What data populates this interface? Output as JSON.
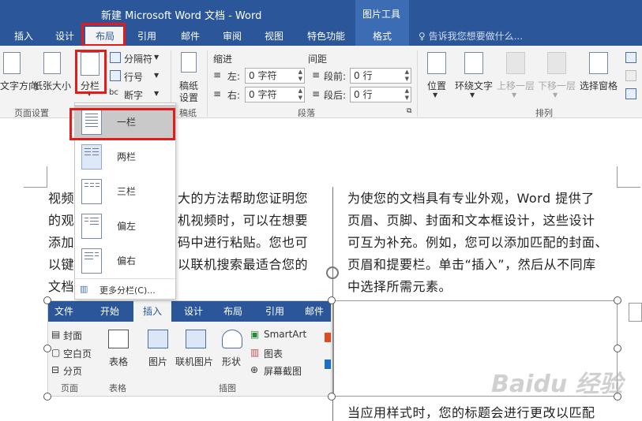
{
  "window": {
    "title": "新建 Microsoft Word 文档 - Word",
    "context_tab_group": "图片工具"
  },
  "tabs": [
    {
      "label": "插入",
      "active": false
    },
    {
      "label": "设计",
      "active": false
    },
    {
      "label": "布局",
      "active": true
    },
    {
      "label": "引用",
      "active": false
    },
    {
      "label": "邮件",
      "active": false
    },
    {
      "label": "审阅",
      "active": false
    },
    {
      "label": "视图",
      "active": false
    },
    {
      "label": "特色功能",
      "active": false
    },
    {
      "label": "格式",
      "active": false
    }
  ],
  "tell_me": "告诉我您想要做什么...",
  "ribbon": {
    "page_setup": {
      "text_direction": "文字方向",
      "paper_size": "纸张大小",
      "columns": "分栏",
      "breaks": "分隔符",
      "line_numbers": "行号",
      "hyphenation": "断字",
      "group_label": "页面设置"
    },
    "manuscript": {
      "button": "稿纸设置",
      "line1": "稿纸",
      "line2": "设置",
      "group_label": "稿纸"
    },
    "paragraph": {
      "indent_label": "缩进",
      "spacing_label": "间距",
      "left_label": "左:",
      "left_value": "0 字符",
      "right_label": "右:",
      "right_value": "0 字符",
      "before_label": "段前:",
      "before_value": "0 行",
      "after_label": "段后:",
      "after_value": "0 行",
      "group_label": "段落"
    },
    "arrange": {
      "position": "位置",
      "wrap_text": "环绕文字",
      "bring_forward": "上移一层",
      "send_backward": "下移一层",
      "selection_pane": "选择窗格",
      "group_label": "排列"
    }
  },
  "columns_menu": {
    "items": [
      {
        "label": "一栏",
        "selected": true
      },
      {
        "label": "两栏",
        "selected": false
      },
      {
        "label": "三栏",
        "selected": false
      },
      {
        "label": "偏左",
        "selected": false
      },
      {
        "label": "偏右",
        "selected": false
      }
    ],
    "more": "更多分栏(C)..."
  },
  "document": {
    "left_col_lines": [
      "视频",
      "大的方法帮助您证明您",
      "的观",
      "机视频时，可以在想要",
      "添加",
      "码中进行粘贴。您也可",
      "以键",
      "以联机搜索最适合您的",
      "文档"
    ],
    "left_col_rows": [
      {
        "a": "视频",
        "b": "大的方法帮助您证明您"
      },
      {
        "a": "的观",
        "b": "机视频时，可以在想要"
      },
      {
        "a": "添加",
        "b": "码中进行粘贴。您也可"
      },
      {
        "a": "以键",
        "b": "以联机搜索最适合您的"
      },
      {
        "a": "文档",
        "b": ""
      }
    ],
    "right_col_lines": [
      "为使您的文档具有专业外观，Word 提供了",
      "页眉、页脚、封面和文本框设计，这些设计",
      "可互为补充。例如，您可以添加匹配的封面、",
      "页眉和提要栏。单击“插入”，然后从不同库",
      "中选择所需元素。"
    ],
    "bottom_right_line": "当应用样式时，您的标题会进行更改以匹配"
  },
  "embedded_picture": {
    "tabs": [
      {
        "label": "文件",
        "active": false
      },
      {
        "label": "开始",
        "active": false
      },
      {
        "label": "插入",
        "active": true
      },
      {
        "label": "设计",
        "active": false
      },
      {
        "label": "布局",
        "active": false
      },
      {
        "label": "引用",
        "active": false
      },
      {
        "label": "邮件",
        "active": false
      }
    ],
    "cover": "封面",
    "blank_page": "空白页",
    "page_break": "分页",
    "table": "表格",
    "picture": "图片",
    "online_picture": "联机图片",
    "shapes": "形状",
    "smartart": "SmartArt",
    "chart": "图表",
    "screenshot": "屏幕截图",
    "group_pages": "页面",
    "group_table": "表格",
    "group_illustrations": "插图"
  },
  "watermark": "Baidu 经验",
  "colors": {
    "brand": "#2b579a",
    "highlight": "#e31b1b",
    "ribbon_bg": "#f3f3f3"
  }
}
